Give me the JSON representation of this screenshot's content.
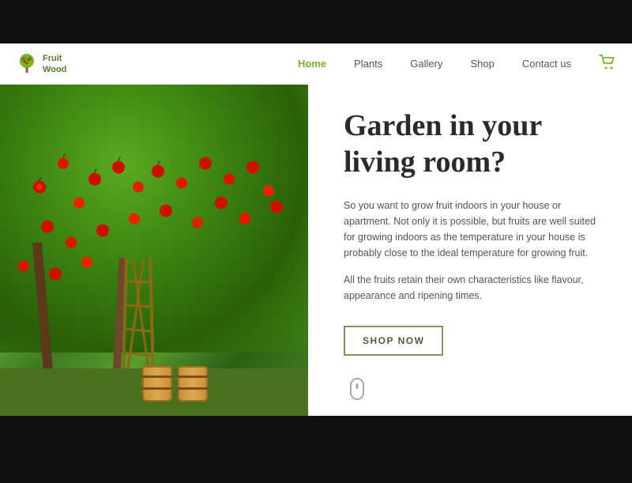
{
  "brand": {
    "name_line1": "Fruit",
    "name_line2": "Wood"
  },
  "nav": {
    "home": "Home",
    "plants": "Plants",
    "gallery": "Gallery",
    "shop": "Shop",
    "contact": "Contact us"
  },
  "hero": {
    "title_line1": "Garden in your",
    "title_line2": "living room?",
    "desc1": "So you want to grow fruit indoors in your house or apartment. Not only it is possible, but fruits are well suited for growing indoors as the temperature in your house is probably close to the ideal temperature for growing fruit.",
    "desc2": "All the fruits retain their own characteristics like flavour, appearance and ripening times.",
    "cta_label": "SHOP NOW"
  },
  "colors": {
    "accent_green": "#7ab528",
    "dark_olive": "#5a7a2a",
    "text_dark": "#2a2a2a",
    "text_muted": "#555555"
  }
}
